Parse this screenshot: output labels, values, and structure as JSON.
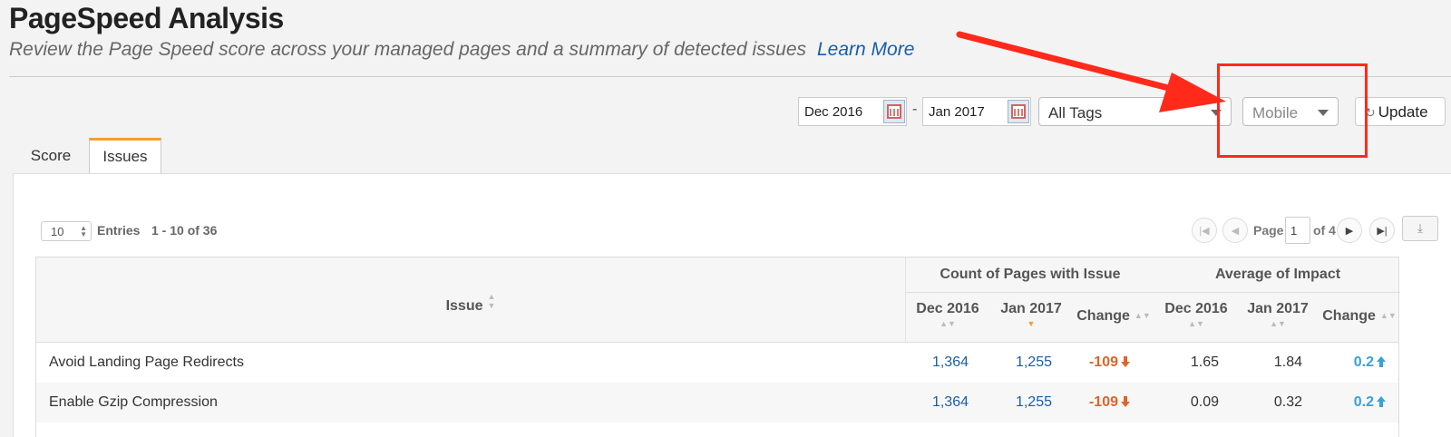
{
  "header": {
    "title": "PageSpeed Analysis",
    "subtitle": "Review the Page Speed score across your managed pages and a summary of detected issues",
    "learn_more": "Learn More"
  },
  "controls": {
    "date_from": "Dec 2016",
    "date_separator": "-",
    "date_to": "Jan 2017",
    "tags_select": "All Tags",
    "device_select": "Mobile",
    "update_label": "Update"
  },
  "tabs": [
    {
      "label": "Score",
      "active": false
    },
    {
      "label": "Issues",
      "active": true
    }
  ],
  "table_controls": {
    "entries_value": "10",
    "entries_label": "Entries",
    "range_label": "1 - 10 of 36",
    "page_label": "Page",
    "page_value": "1",
    "page_of": "of 4"
  },
  "table": {
    "issue_header": "Issue",
    "group_count": "Count of Pages with Issue",
    "group_impact": "Average of Impact",
    "sub_headers": [
      "Dec 2016",
      "Jan 2017",
      "Change",
      "Dec 2016",
      "Jan 2017",
      "Change"
    ],
    "rows": [
      {
        "issue": "Avoid Landing Page Redirects",
        "count_dec": "1,364",
        "count_jan": "1,255",
        "count_change": "-109",
        "impact_dec": "1.65",
        "impact_jan": "1.84",
        "impact_change": "0.2"
      },
      {
        "issue": "Enable Gzip Compression",
        "count_dec": "1,364",
        "count_jan": "1,255",
        "count_change": "-109",
        "impact_dec": "0.09",
        "impact_jan": "0.32",
        "impact_change": "0.2"
      }
    ]
  },
  "colors": {
    "link": "#1a5ea8",
    "negative": "#e0632a",
    "positive": "#3aa0d8",
    "tab_accent": "#f0a030",
    "annotation": "#ff2a1a"
  }
}
